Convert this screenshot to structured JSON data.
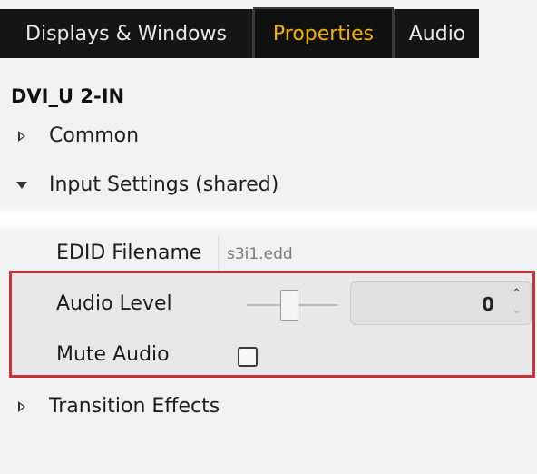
{
  "tabs": {
    "displays_windows": "Displays & Windows",
    "properties": "Properties",
    "audio": "Audio"
  },
  "panel": {
    "title": "DVI_U 2-IN",
    "sections": {
      "common": "Common",
      "input_settings": "Input Settings (shared)",
      "transition_effects": "Transition Effects"
    },
    "edid": {
      "label": "EDID Filename",
      "value": "s3i1.edd"
    },
    "audio_level": {
      "label": "Audio Level",
      "value": "0"
    },
    "mute_audio": {
      "label": "Mute Audio",
      "checked": false
    }
  },
  "icons": {
    "collapsed": "chevron-right-icon",
    "expanded": "chevron-down-icon",
    "spin_up": "spin-up-icon",
    "spin_down": "spin-down-icon"
  },
  "colors": {
    "active_tab_text": "#f0b400",
    "highlight_border": "#c8323c",
    "tab_background": "#151515"
  }
}
